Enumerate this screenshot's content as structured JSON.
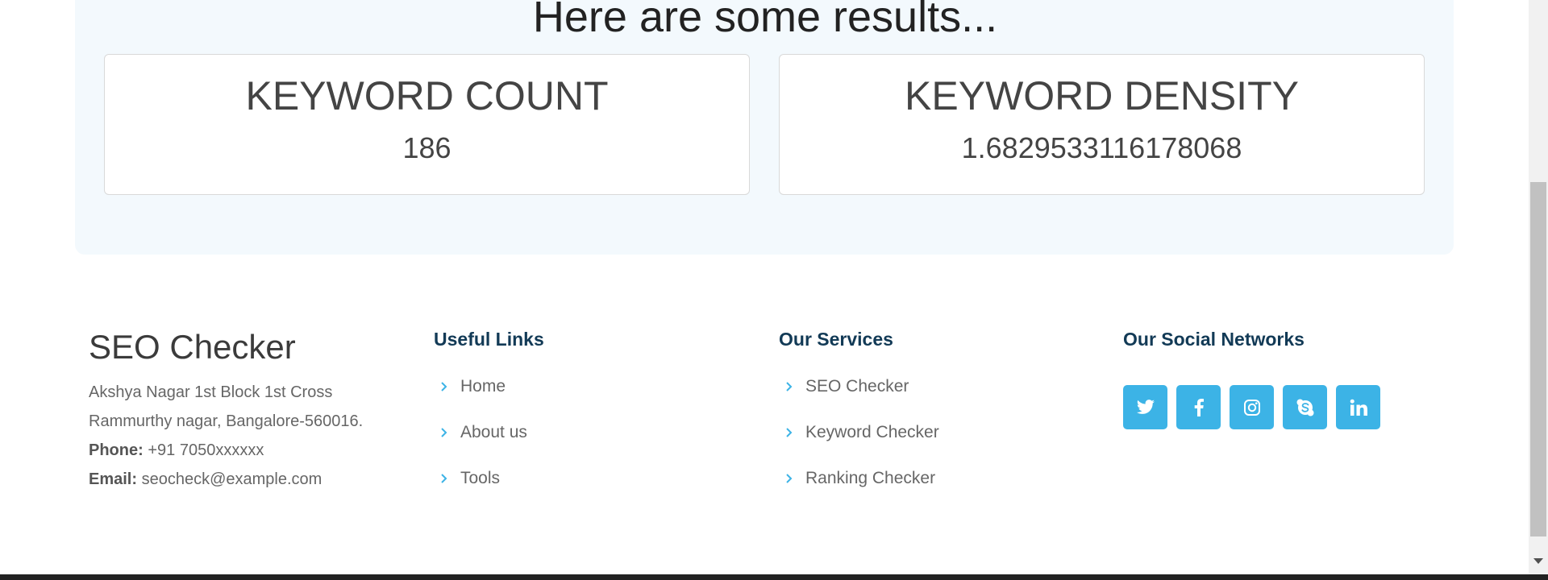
{
  "results": {
    "heading": "Here are some results...",
    "cards": [
      {
        "title": "KEYWORD COUNT",
        "value": "186"
      },
      {
        "title": "KEYWORD DENSITY",
        "value": "1.6829533116178068"
      }
    ]
  },
  "footer": {
    "brand": "SEO Checker",
    "address_line1": "Akshya Nagar 1st Block 1st Cross",
    "address_line2": "Rammurthy nagar, Bangalore-560016.",
    "phone_label": "Phone:",
    "phone_value": " +91 7050xxxxxx",
    "email_label": "Email:",
    "email_value": " seocheck@example.com",
    "useful_links": {
      "heading": "Useful Links",
      "items": [
        "Home",
        "About us",
        "Tools"
      ]
    },
    "services": {
      "heading": "Our Services",
      "items": [
        "SEO Checker",
        "Keyword Checker",
        "Ranking Checker"
      ]
    },
    "social": {
      "heading": "Our Social Networks",
      "icons": [
        "twitter-icon",
        "facebook-icon",
        "instagram-icon",
        "skype-icon",
        "linkedin-icon"
      ]
    }
  },
  "colors": {
    "accent": "#3cb3e6",
    "heading_dark": "#123a56",
    "panel_bg": "#f3f9fd"
  }
}
